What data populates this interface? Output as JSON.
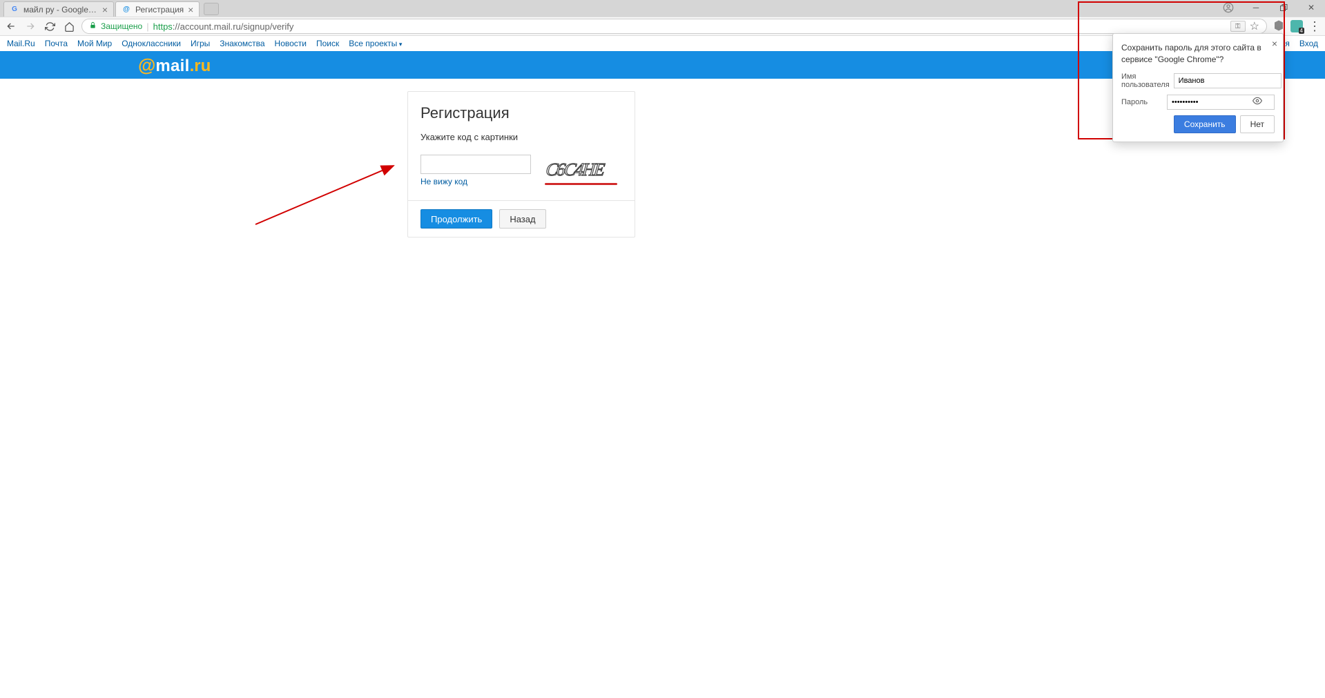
{
  "tabs": [
    {
      "title": "майл ру - Google Search",
      "favicon": "G"
    },
    {
      "title": "Регистрация",
      "favicon": "@"
    }
  ],
  "addressBar": {
    "secureLabel": "Защищено",
    "url_prefix": "https",
    "url_rest": "://account.mail.ru/signup/verify"
  },
  "portalNav": {
    "items": [
      "Mail.Ru",
      "Почта",
      "Мой Мир",
      "Одноклассники",
      "Игры",
      "Знакомства",
      "Новости",
      "Поиск"
    ],
    "allProjects": "Все проекты",
    "rightItems": [
      "Регистрация",
      "Вход"
    ]
  },
  "logo": {
    "at": "@",
    "mail": "mail",
    "ru": ".ru"
  },
  "card": {
    "title": "Регистрация",
    "subtitle": "Укажите код с картинки",
    "noCode": "Не вижу код",
    "continue": "Продолжить",
    "back": "Назад",
    "captchaText": "C6C4HE"
  },
  "pwPopup": {
    "message": "Сохранить пароль для этого сайта в сервисе \"Google Chrome\"?",
    "usernameLabel": "Имя пользователя",
    "usernameValue": "Иванов",
    "passwordLabel": "Пароль",
    "passwordValue": "••••••••••",
    "save": "Сохранить",
    "no": "Нет"
  },
  "extBadge": "4"
}
